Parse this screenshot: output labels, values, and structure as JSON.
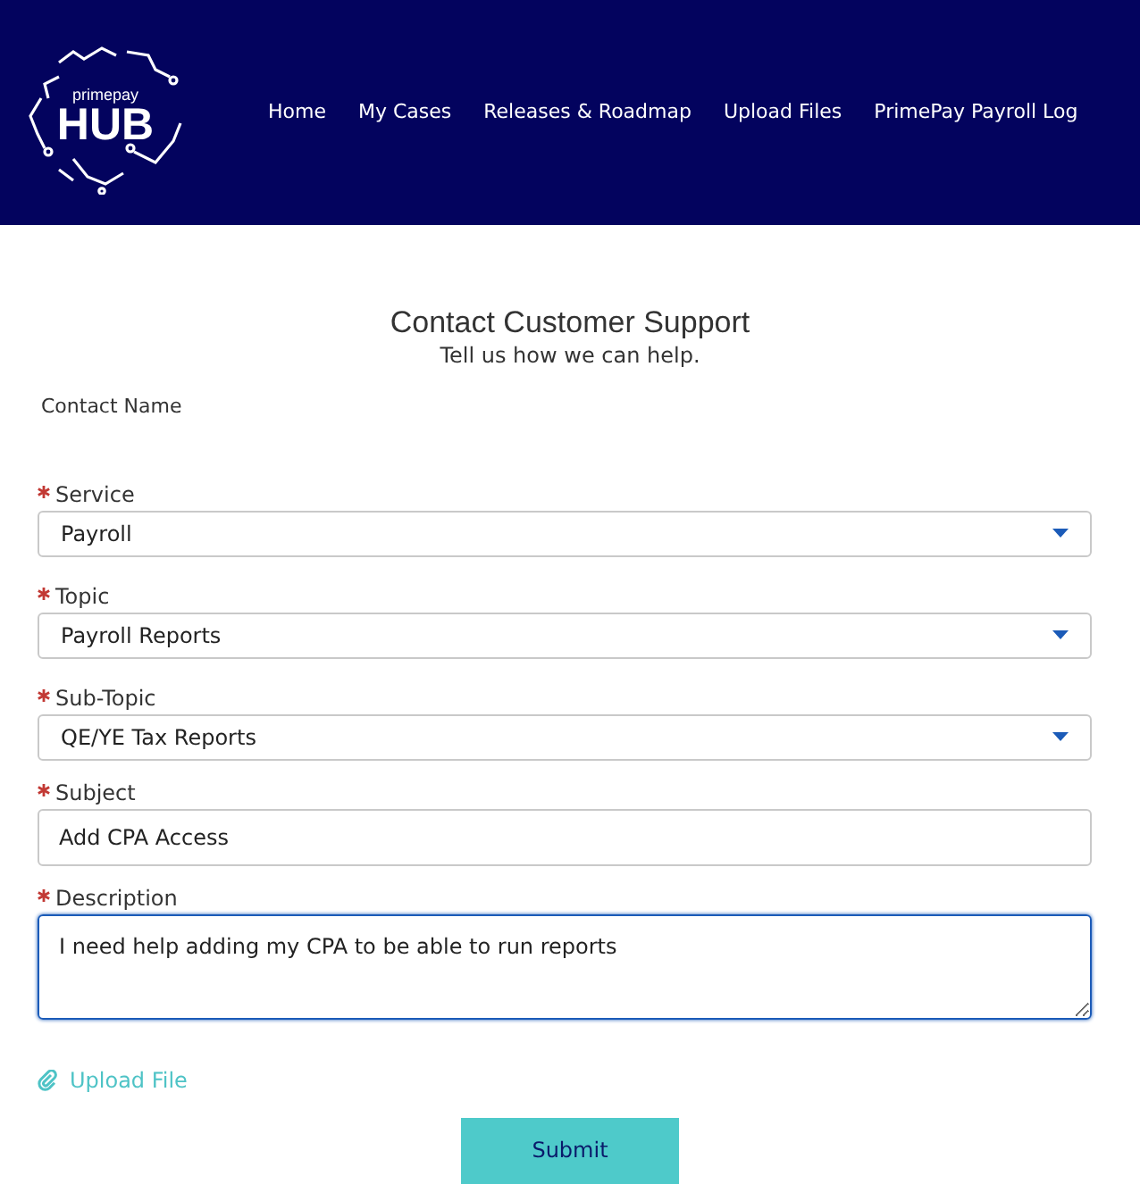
{
  "header": {
    "logo": {
      "brand": "primepay",
      "title": "HUB"
    },
    "nav": [
      {
        "label": "Home"
      },
      {
        "label": "My Cases"
      },
      {
        "label": "Releases & Roadmap"
      },
      {
        "label": "Upload Files"
      },
      {
        "label": "PrimePay Payroll Log"
      }
    ]
  },
  "form": {
    "title": "Contact Customer Support",
    "subtitle": "Tell us how we can help.",
    "contact_name_label": "Contact Name",
    "fields": [
      {
        "kind": "select",
        "label": "Service",
        "required": true,
        "value": "Payroll",
        "focused": false
      },
      {
        "kind": "select",
        "label": "Topic",
        "required": true,
        "value": "Payroll Reports",
        "focused": false
      },
      {
        "kind": "select",
        "label": "Sub-Topic",
        "required": true,
        "value": "QE/YE Tax Reports",
        "focused": false
      },
      {
        "kind": "text",
        "label": "Subject",
        "required": true,
        "value": "Add CPA Access",
        "focused": false
      },
      {
        "kind": "textarea",
        "label": "Description",
        "required": true,
        "value": "I need help adding my CPA to be able to run reports",
        "focused": true
      }
    ],
    "upload_link": "Upload File",
    "submit": "Submit"
  }
}
